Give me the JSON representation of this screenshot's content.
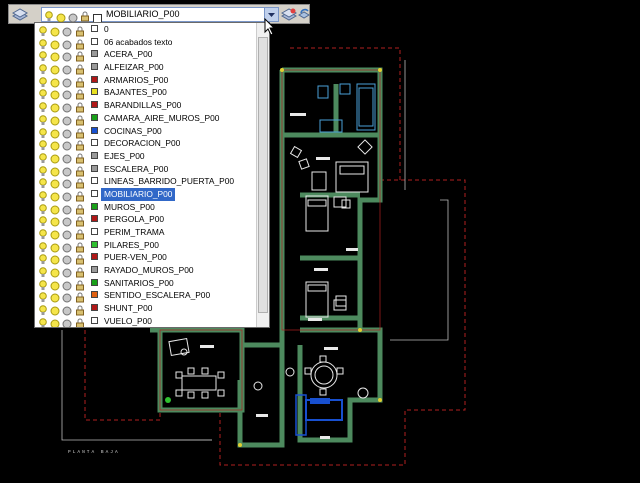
{
  "layer_combo": {
    "current": "MOBILIARIO_P00"
  },
  "layers": [
    {
      "name": "0",
      "color": "#ffffff"
    },
    {
      "name": "06 acabados texto",
      "color": "#ffffff"
    },
    {
      "name": "ACERA_P00",
      "color": "#9a9a9a"
    },
    {
      "name": "ALFEIZAR_P00",
      "color": "#9a9a9a"
    },
    {
      "name": "ARMARIOS_P00",
      "color": "#b01818"
    },
    {
      "name": "BAJANTES_P00",
      "color": "#e8e020"
    },
    {
      "name": "BARANDILLAS_P00",
      "color": "#b01818"
    },
    {
      "name": "CAMARA_AIRE_MUROS_P00",
      "color": "#18a018"
    },
    {
      "name": "COCINAS_P00",
      "color": "#1850d0"
    },
    {
      "name": "DECORACION_P00",
      "color": "#ffffff"
    },
    {
      "name": "EJES_P00",
      "color": "#9a9a9a"
    },
    {
      "name": "ESCALERA_P00",
      "color": "#9a9a9a"
    },
    {
      "name": "LINEAS_BARRIDO_PUERTA_P00",
      "color": "#ffffff"
    },
    {
      "name": "MOBILIARIO_P00",
      "color": "#ffffff",
      "selected": true
    },
    {
      "name": "MUROS_P00",
      "color": "#18a018"
    },
    {
      "name": "PERGOLA_P00",
      "color": "#b01818"
    },
    {
      "name": "PERIM_TRAMA",
      "color": "#ffffff"
    },
    {
      "name": "PILARES_P00",
      "color": "#30c030"
    },
    {
      "name": "PUER-VEN_P00",
      "color": "#b01818"
    },
    {
      "name": "RAYADO_MUROS_P00",
      "color": "#9a9a9a"
    },
    {
      "name": "SANITARIOS_P00",
      "color": "#18a018"
    },
    {
      "name": "SENTIDO_ESCALERA_P00",
      "color": "#e06010"
    },
    {
      "name": "SHUNT_P00",
      "color": "#b01818"
    },
    {
      "name": "VUELO_P00",
      "color": "#ffffff"
    }
  ],
  "drawing": {
    "caption": "PLANTA BAJA"
  },
  "colors": {
    "walls": "#4d8a5e",
    "dim_red": "#b02020",
    "furniture": "#e8e8e8",
    "kitchen": "#1850d0"
  }
}
